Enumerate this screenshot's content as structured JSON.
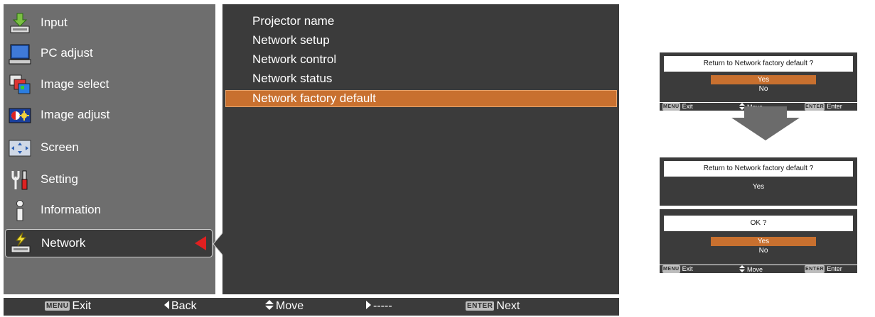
{
  "sidebar": {
    "items": [
      {
        "label": "Input",
        "icon": "input-icon"
      },
      {
        "label": "PC adjust",
        "icon": "pc-adjust-icon"
      },
      {
        "label": "Image select",
        "icon": "image-select-icon"
      },
      {
        "label": "Image adjust",
        "icon": "image-adjust-icon"
      },
      {
        "label": "Screen",
        "icon": "screen-icon"
      },
      {
        "label": "Setting",
        "icon": "setting-icon"
      },
      {
        "label": "Information",
        "icon": "information-icon"
      },
      {
        "label": "Network",
        "icon": "network-icon",
        "selected": true
      }
    ]
  },
  "submenu": {
    "items": [
      {
        "label": "Projector name"
      },
      {
        "label": "Network setup"
      },
      {
        "label": "Network control"
      },
      {
        "label": "Network status"
      },
      {
        "label": "Network factory default",
        "selected": true
      }
    ]
  },
  "bottombar": {
    "exit_key": "MENU",
    "exit_label": "Exit",
    "back_label": "Back",
    "move_label": "Move",
    "next_placeholder": "-----",
    "enter_key": "ENTER",
    "next_label": "Next"
  },
  "dialog_step1": {
    "question": "Return to Network factory default ?",
    "options": [
      "Yes",
      "No"
    ],
    "selected_option": "Yes",
    "help": {
      "exit_key": "MENU",
      "exit_label": "Exit",
      "move_label": "Move",
      "enter_key": "ENTER",
      "enter_label": "Enter"
    }
  },
  "dialog_step2": {
    "question": "Return to Network factory default ?",
    "answer": "Yes"
  },
  "dialog_step3": {
    "question": "OK ?",
    "options": [
      "Yes",
      "No"
    ],
    "selected_option": "Yes",
    "help": {
      "exit_key": "MENU",
      "exit_label": "Exit",
      "move_label": "Move",
      "enter_key": "ENTER",
      "enter_label": "Enter"
    }
  },
  "colors": {
    "menu_gray": "#6e6e6e",
    "panel_dark": "#3b3b3b",
    "highlight_orange": "#c8702f",
    "pointer_red": "#e02020"
  }
}
